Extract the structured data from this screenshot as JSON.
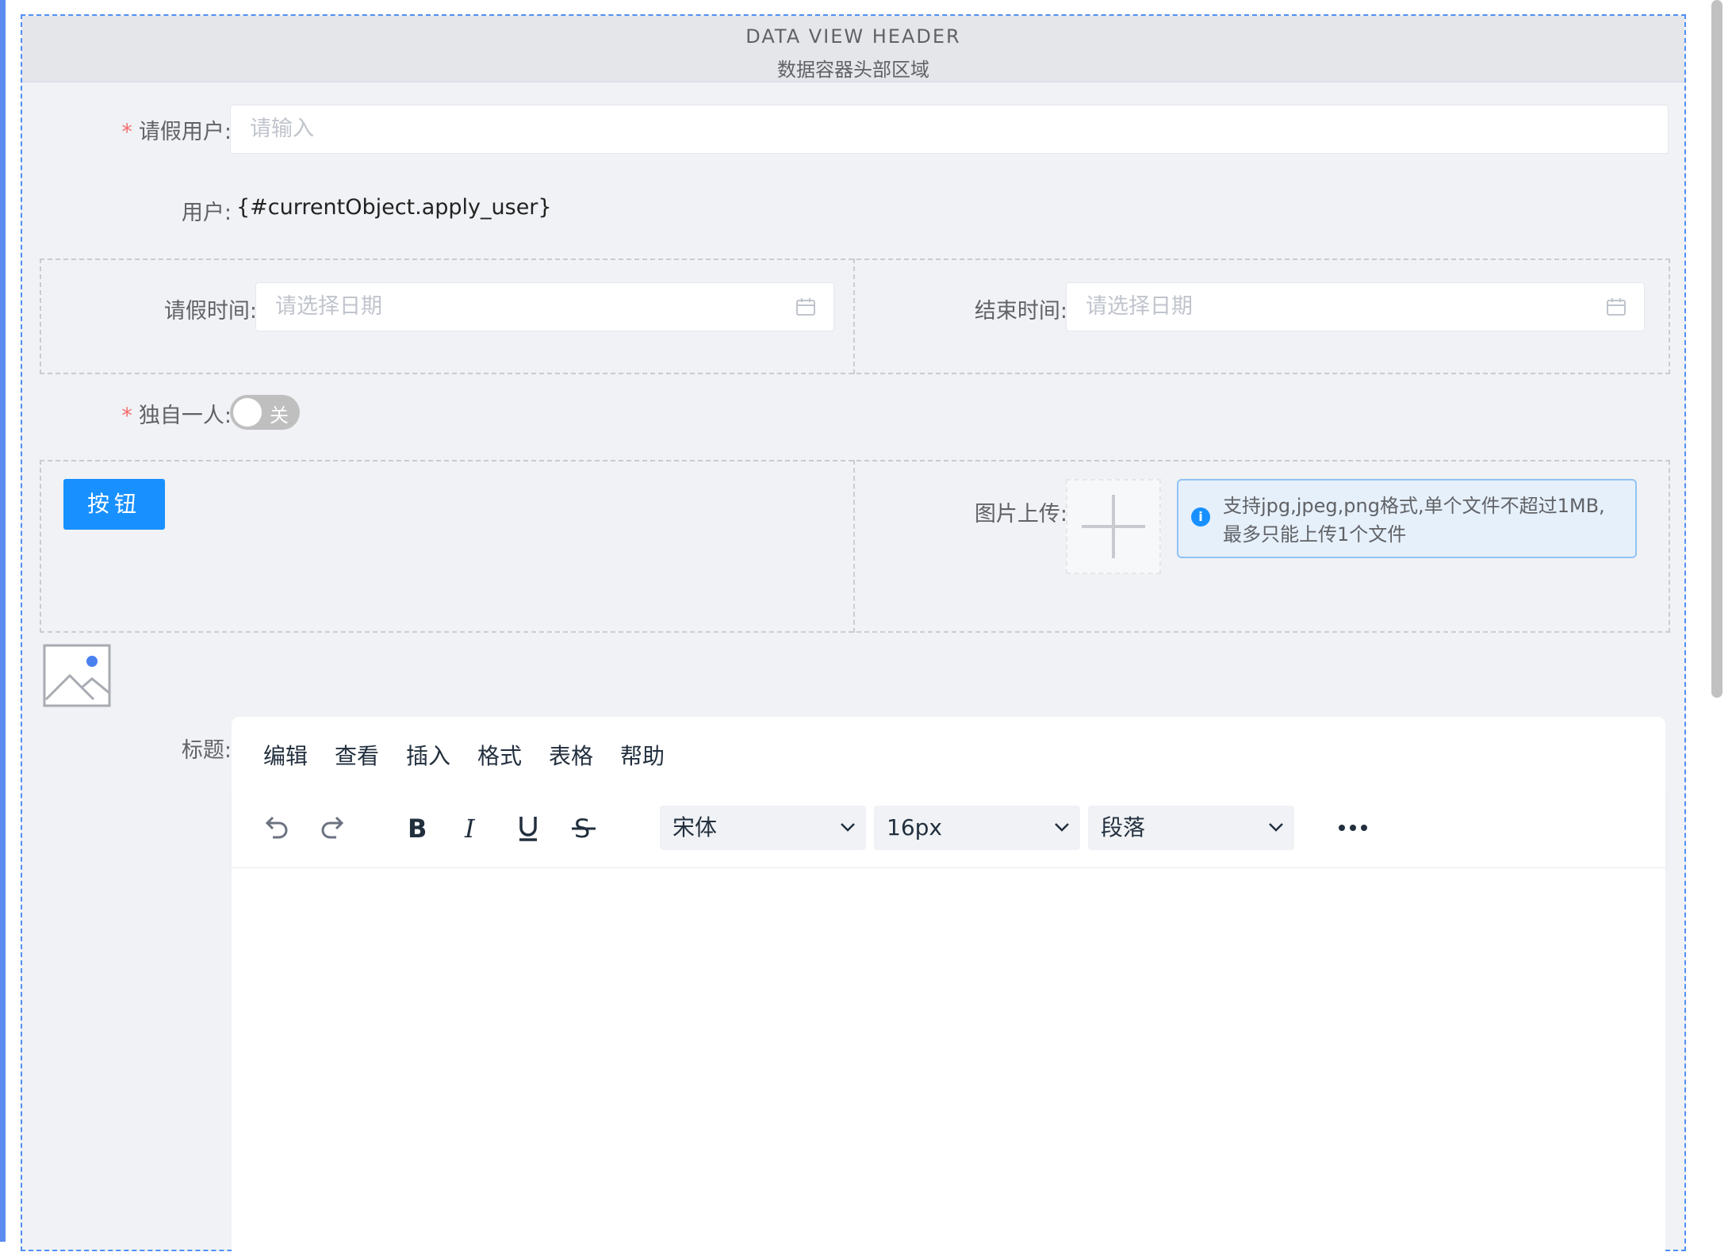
{
  "header": {
    "title_en": "DATA VIEW HEADER",
    "title_zh": "数据容器头部区域"
  },
  "form": {
    "leave_user": {
      "required_mark": "*",
      "label": "请假用户:",
      "placeholder": "请输入"
    },
    "user": {
      "label": "用户:",
      "value": "{#currentObject.apply_user}"
    },
    "leave_time": {
      "label": "请假时间:",
      "placeholder": "请选择日期"
    },
    "end_time": {
      "label": "结束时间:",
      "placeholder": "请选择日期"
    },
    "alone": {
      "required_mark": "*",
      "label": "独自一人:",
      "switch_text": "关",
      "checked": false
    },
    "button": {
      "label": "按钮"
    },
    "image_upload": {
      "label": "图片上传:",
      "tip": "支持jpg,jpeg,png格式,单个文件不超过1MB,最多只能上传1个文件"
    },
    "title": {
      "label": "标题:"
    }
  },
  "editor": {
    "menus": [
      "编辑",
      "查看",
      "插入",
      "格式",
      "表格",
      "帮助"
    ],
    "font_family": "宋体",
    "font_size": "16px",
    "block_format": "段落",
    "tools": [
      "undo-icon",
      "redo-icon",
      "bold-icon",
      "italic-icon",
      "underline-icon",
      "strikethrough-icon"
    ]
  },
  "colors": {
    "primary": "#1890ff",
    "required": "#f56c6c",
    "frame_border": "#4f8ef7",
    "background": "#f0f2f5"
  }
}
